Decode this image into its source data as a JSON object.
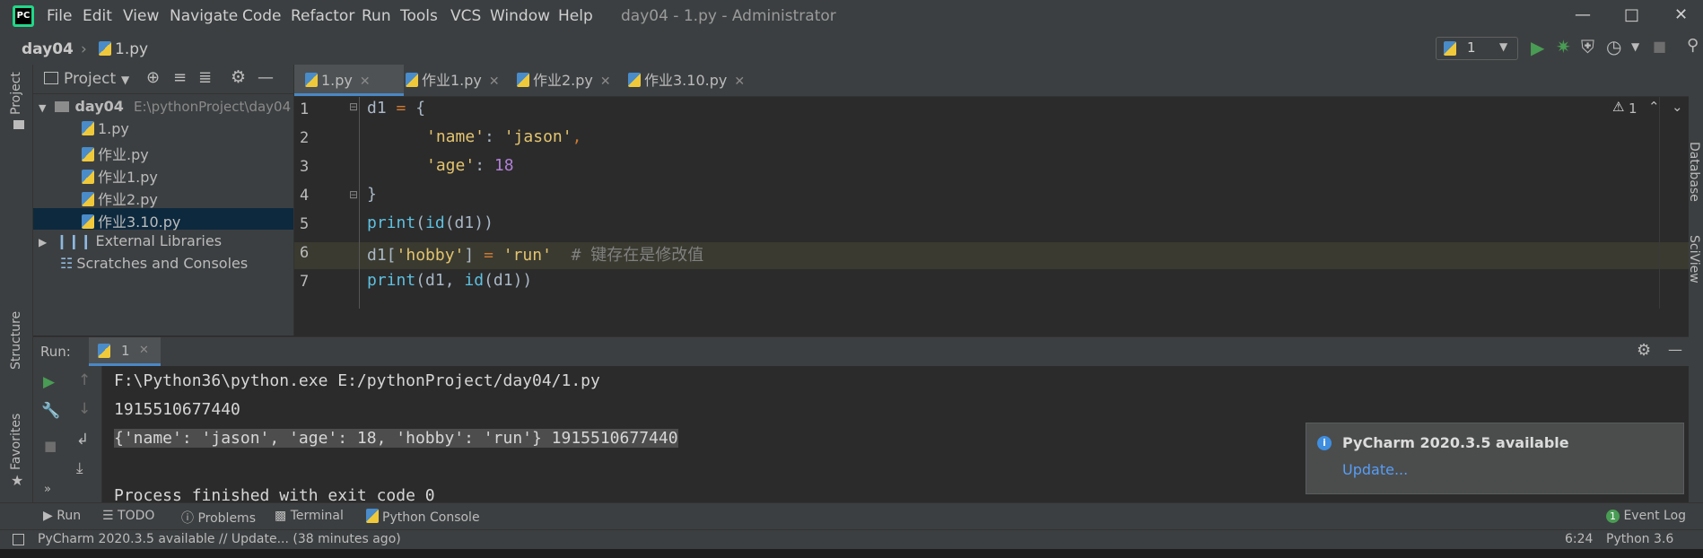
{
  "menu": [
    "File",
    "Edit",
    "View",
    "Navigate",
    "Code",
    "Refactor",
    "Run",
    "Tools",
    "VCS",
    "Window",
    "Help"
  ],
  "window_title": "day04 - 1.py - Administrator",
  "breadcrumb": {
    "project": "day04",
    "file": "1.py"
  },
  "run_config": "1",
  "left_strip": {
    "project": "Project",
    "structure": "Structure",
    "favorites": "Favorites"
  },
  "right_strip": {
    "database": "Database",
    "sciview": "SciView"
  },
  "project_panel": {
    "title": "Project",
    "root": {
      "name": "day04",
      "path": "E:\\pythonProject\\day04"
    },
    "files": [
      "1.py",
      "作业.py",
      "作业1.py",
      "作业2.py",
      "作业3.10.py"
    ],
    "selected_file": "作业3.10.py",
    "external": "External Libraries",
    "scratches": "Scratches and Consoles"
  },
  "tabs": [
    "1.py",
    "作业1.py",
    "作业2.py",
    "作业3.10.py"
  ],
  "active_tab": "1.py",
  "editor": {
    "line_numbers": [
      "1",
      "2",
      "3",
      "4",
      "5",
      "6",
      "7"
    ],
    "lines": {
      "l1a": "d1",
      "l1b": " = ",
      "l1c": "{",
      "l2a": "'name'",
      "l2b": ": ",
      "l2c": "'jason'",
      "l2d": ",",
      "l3a": "'age'",
      "l3b": ": ",
      "l3c": "18",
      "l4": "}",
      "l5a": "print",
      "l5b": "(",
      "l5c": "id",
      "l5d": "(d1))",
      "l6a": "d1[",
      "l6b": "'hobby'",
      "l6c": "] ",
      "l6d": "=",
      "l6e": " ",
      "l6f": "'run'",
      "l6g": "  # 键存在是修改值",
      "l7a": "print",
      "l7b": "(d1, ",
      "l7c": "id",
      "l7d": "(d1))"
    },
    "warning_count": "1"
  },
  "run_panel": {
    "label": "Run:",
    "tab": "1",
    "console": [
      "F:\\Python36\\python.exe E:/pythonProject/day04/1.py",
      "1915510677440",
      "{'name': 'jason', 'age': 18, 'hobby': 'run'} 1915510677440",
      "",
      "Process finished with exit code 0"
    ]
  },
  "notification": {
    "title": "PyCharm 2020.3.5 available",
    "link": "Update..."
  },
  "bottom_tools": [
    "Run",
    "TODO",
    "Problems",
    "Terminal",
    "Python Console"
  ],
  "event_log": {
    "count": "1",
    "label": "Event Log"
  },
  "status": {
    "message": "PyCharm 2020.3.5 available // Update... (38 minutes ago)",
    "position": "6:24",
    "interpreter": "Python 3.6"
  },
  "colors": {
    "accent": "#4a88c7",
    "run_green": "#499c54",
    "string": "#e3c46f",
    "keyword": "#cc7832",
    "number": "#b07fd6"
  }
}
